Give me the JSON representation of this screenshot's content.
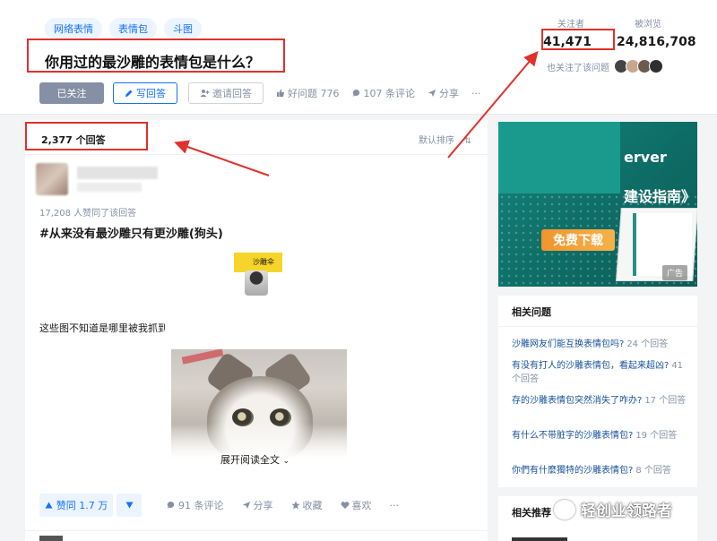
{
  "topics": [
    "网络表情",
    "表情包",
    "斗图"
  ],
  "question": {
    "title": "你用过的最沙雕的表情包是什么？"
  },
  "actions": {
    "follow": "已关注",
    "write_answer": "写回答",
    "invite": "邀请回答",
    "good_question": "好问题 776",
    "comments": "107 条评论",
    "share": "分享",
    "more": "···"
  },
  "stats": {
    "followers_label": "关注者",
    "followers_value": "41,471",
    "views_label": "被浏览",
    "views_value": "24,816,708",
    "followers_note": "也关注了该问题"
  },
  "answers": {
    "count": "2,377 个回答",
    "sort": "默认排序"
  },
  "answer": {
    "likes_note": "17,208 人赞同了该回答",
    "headline": "#从来没有最沙雕只有更沙雕(狗头)",
    "meme_caption": "沙雕伞",
    "body": "这些图不知道是哪里被我抓到",
    "expand": "展开阅读全文",
    "vote": "赞同 1.7 万",
    "comments": "91 条评论",
    "share": "分享",
    "favorite": "收藏",
    "like": "喜欢",
    "more": "···"
  },
  "ad": {
    "line1": "erver",
    "line2": "建设指南》",
    "download": "免费下载",
    "tag": "广告"
  },
  "related": {
    "title": "相关问题",
    "items": [
      {
        "q": "沙雕网友们能互换表情包吗?",
        "count": "24 个回答"
      },
      {
        "q": "有没有打人的沙雕表情包，看起来超凶?",
        "count": "41 个回答"
      },
      {
        "q": "存的沙雕表情包突然消失了咋办?",
        "count": "17 个回答"
      },
      {
        "q": "有什么不带脏字的沙雕表情包?",
        "count": "19 个回答"
      },
      {
        "q": "你們有什麼獨特的沙雕表情包?",
        "count": "8 个回答"
      }
    ]
  },
  "recommend": {
    "title": "相关推荐"
  },
  "watermark": "轻创业领路者",
  "colors": {
    "accent": "#1772f6",
    "highlight": "#e0312c",
    "muted": "#8590a6"
  }
}
